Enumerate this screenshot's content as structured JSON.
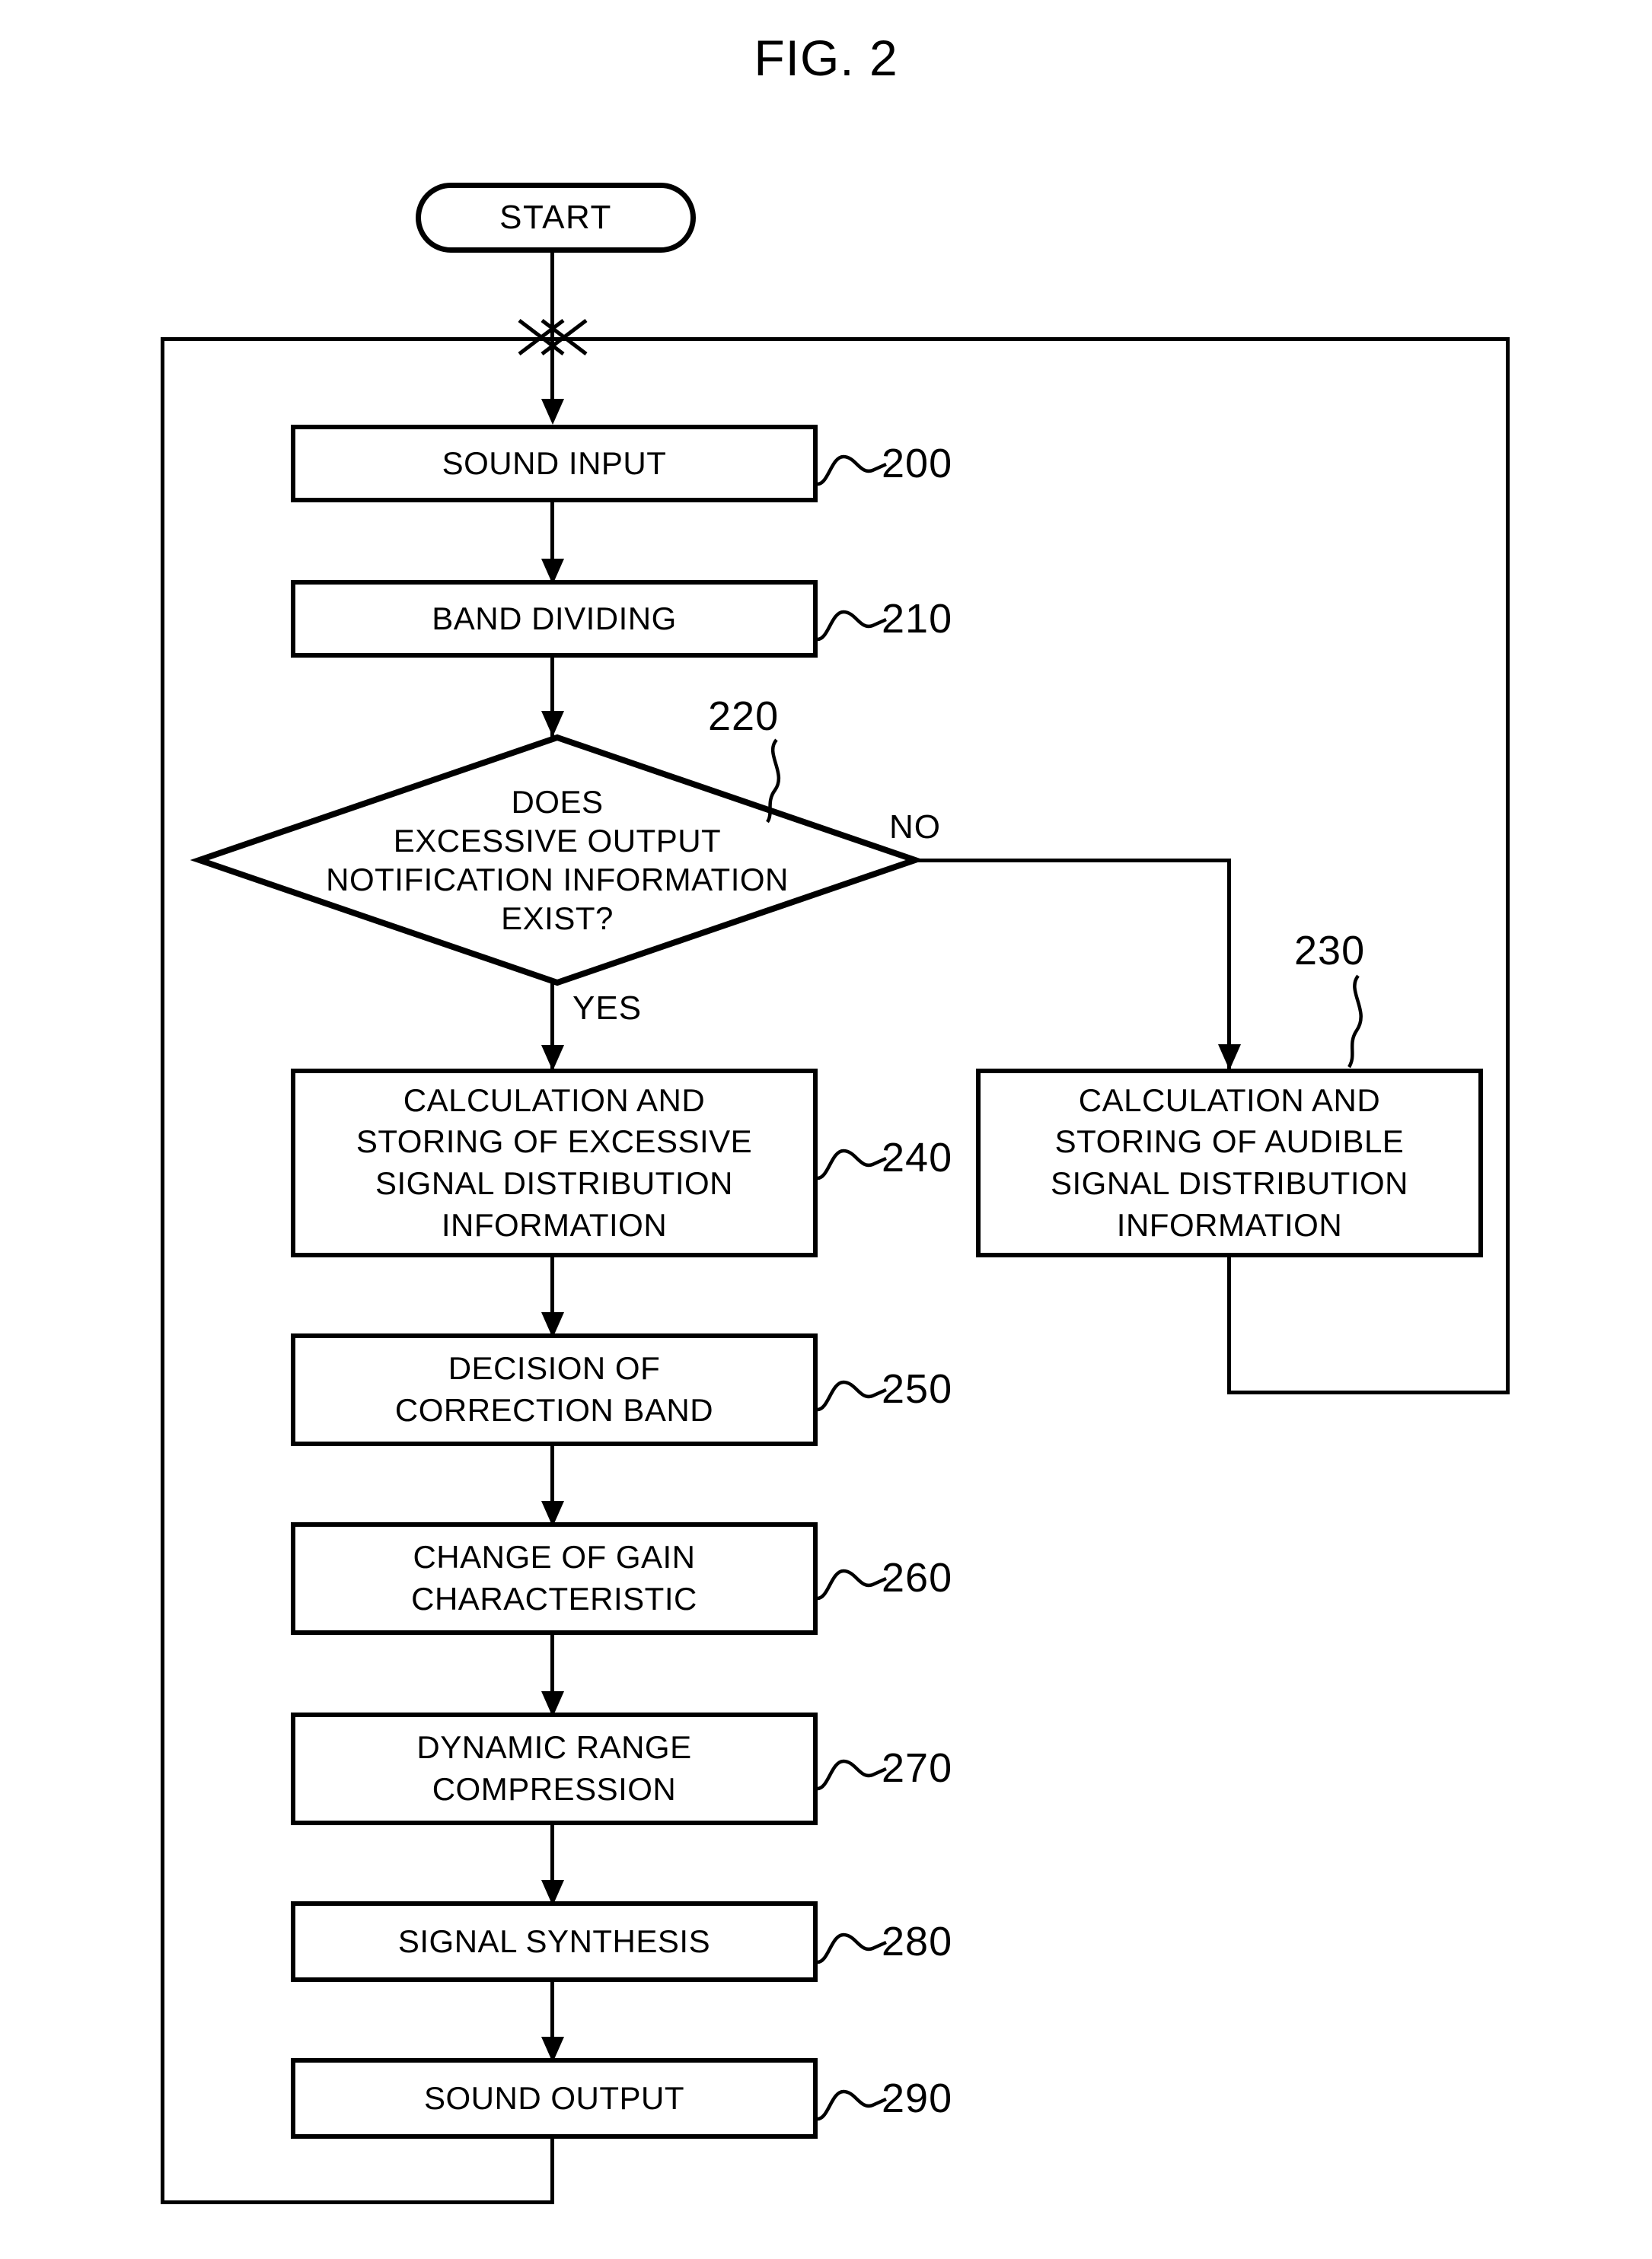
{
  "figure": {
    "title": "FIG. 2"
  },
  "flowchart": {
    "type": "flowchart",
    "orientation": "top-to-bottom",
    "start": {
      "label": "START",
      "shape": "terminator"
    },
    "branch_labels": {
      "yes": "YES",
      "no": "NO"
    },
    "nodes": [
      {
        "ref": "200",
        "label": "SOUND INPUT",
        "shape": "process"
      },
      {
        "ref": "210",
        "label": "BAND DIVIDING",
        "shape": "process"
      },
      {
        "ref": "220",
        "label": "DOES\nEXCESSIVE OUTPUT\nNOTIFICATION INFORMATION\nEXIST?",
        "shape": "decision"
      },
      {
        "ref": "230",
        "label": "CALCULATION AND\nSTORING OF AUDIBLE\nSIGNAL DISTRIBUTION\nINFORMATION",
        "shape": "process"
      },
      {
        "ref": "240",
        "label": "CALCULATION AND\nSTORING OF EXCESSIVE\nSIGNAL DISTRIBUTION\nINFORMATION",
        "shape": "process"
      },
      {
        "ref": "250",
        "label": "DECISION OF\nCORRECTION BAND",
        "shape": "process"
      },
      {
        "ref": "260",
        "label": "CHANGE OF GAIN\nCHARACTERISTIC",
        "shape": "process"
      },
      {
        "ref": "270",
        "label": "DYNAMIC RANGE\nCOMPRESSION",
        "shape": "process"
      },
      {
        "ref": "280",
        "label": "SIGNAL SYNTHESIS",
        "shape": "process"
      },
      {
        "ref": "290",
        "label": "SOUND OUTPUT",
        "shape": "process"
      }
    ],
    "edges": [
      {
        "from": "START",
        "to": "200",
        "label": ""
      },
      {
        "from": "200",
        "to": "210",
        "label": ""
      },
      {
        "from": "210",
        "to": "220",
        "label": ""
      },
      {
        "from": "220",
        "to": "240",
        "label": "YES"
      },
      {
        "from": "220",
        "to": "230",
        "label": "NO"
      },
      {
        "from": "240",
        "to": "250",
        "label": ""
      },
      {
        "from": "250",
        "to": "260",
        "label": ""
      },
      {
        "from": "260",
        "to": "270",
        "label": ""
      },
      {
        "from": "270",
        "to": "280",
        "label": ""
      },
      {
        "from": "280",
        "to": "290",
        "label": ""
      },
      {
        "from": "290",
        "to": "200",
        "label": ""
      },
      {
        "from": "230",
        "to": "200",
        "label": ""
      }
    ]
  }
}
